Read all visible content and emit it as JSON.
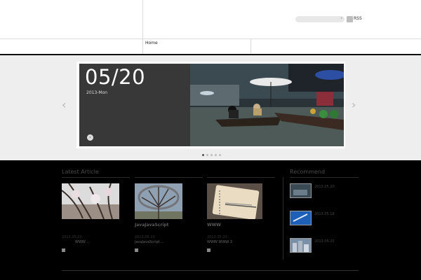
{
  "header": {
    "search_go": "›",
    "rss_label": "RSS",
    "nav": {
      "home": "Home"
    }
  },
  "slider": {
    "date": "05/20",
    "subdate": "2013-Mon",
    "dots_total": 5,
    "dots_active": 1
  },
  "latest": {
    "title": "Latest Article",
    "articles": [
      {
        "title": "",
        "date": "2013.05.20",
        "excerpt": "WWW ..."
      },
      {
        "title": "JavaJavaScript",
        "date": "2013.05.20",
        "excerpt": "JavaJavaScript ..."
      },
      {
        "title": "WWW",
        "date": "2013.05.20",
        "excerpt": "WWW WWW 3"
      }
    ]
  },
  "recommend": {
    "title": "Recommend",
    "items": [
      {
        "date": "2013.05.20"
      },
      {
        "date": "2013.05.18"
      },
      {
        "date": "2013.05.20"
      }
    ]
  }
}
